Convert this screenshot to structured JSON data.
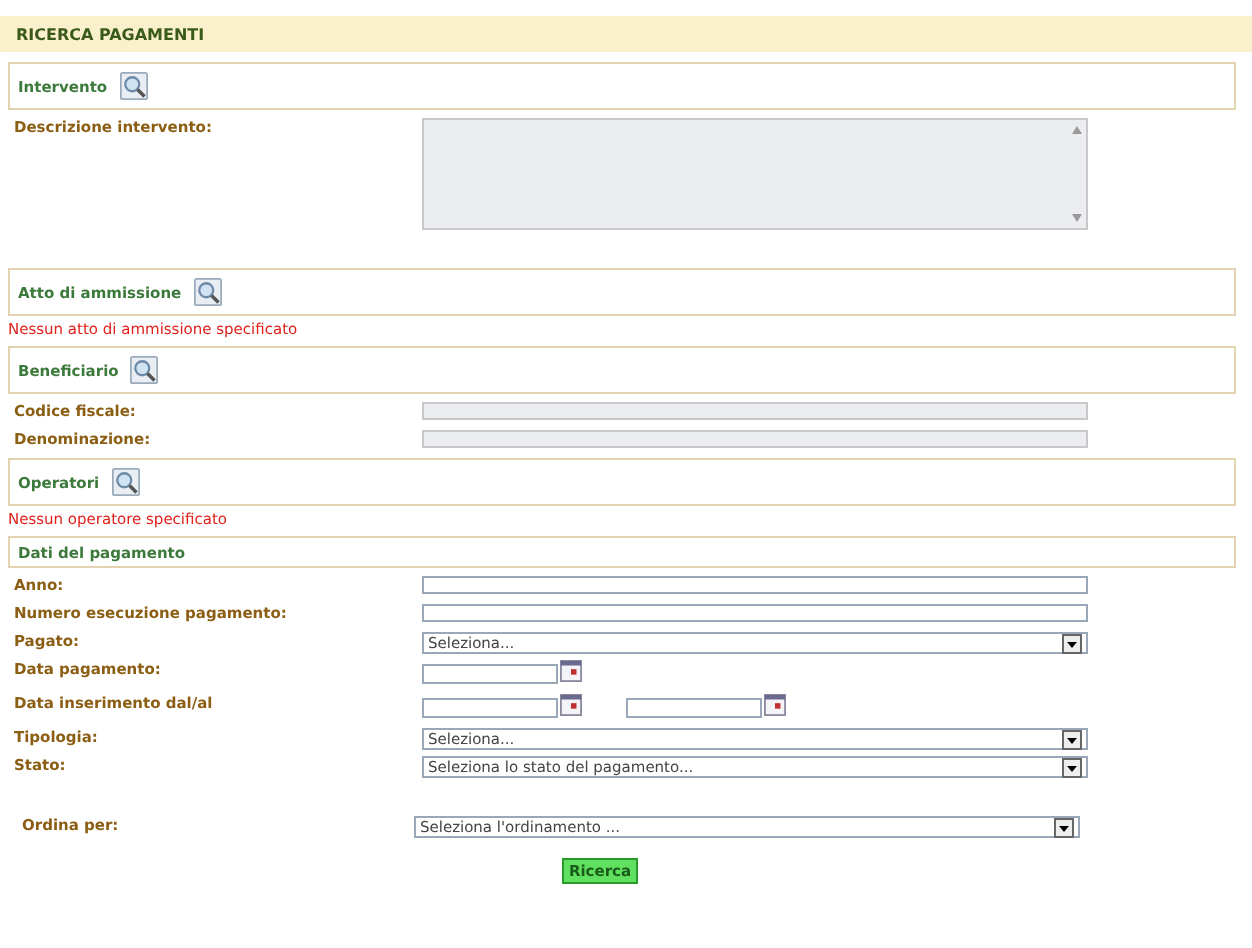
{
  "title": "RICERCA PAGAMENTI",
  "blocks": [
    {
      "kind": "search_panel",
      "title": "Intervento"
    },
    {
      "kind": "textarea",
      "label": "Descrizione intervento:"
    },
    {
      "kind": "search_panel",
      "title": "Atto di ammissione",
      "message": "Nessun atto di ammissione specificato"
    },
    {
      "kind": "search_panel",
      "title": "Beneficiario"
    },
    {
      "kind": "readonly_text",
      "label": "Codice fiscale:"
    },
    {
      "kind": "readonly_text",
      "label": "Denominazione:"
    },
    {
      "kind": "search_panel",
      "title": "Operatori",
      "message": "Nessun operatore specificato"
    },
    {
      "kind": "panel",
      "title": "Dati del pagamento"
    },
    {
      "kind": "text",
      "label": "Anno:"
    },
    {
      "kind": "text",
      "label": "Numero esecuzione pagamento:"
    },
    {
      "kind": "select",
      "label": "Pagato:",
      "value": "Seleziona..."
    },
    {
      "kind": "date",
      "label": "Data pagamento:"
    },
    {
      "kind": "daterange",
      "label": "Data inserimento dal/al"
    },
    {
      "kind": "select",
      "label": "Tipologia:",
      "value": "Seleziona..."
    },
    {
      "kind": "select",
      "label": "Stato:",
      "value": "Seleziona lo stato del pagamento..."
    }
  ],
  "sort": {
    "label": "Ordina per:",
    "value": "Seleziona l'ordinamento ..."
  },
  "button": "Ricerca"
}
